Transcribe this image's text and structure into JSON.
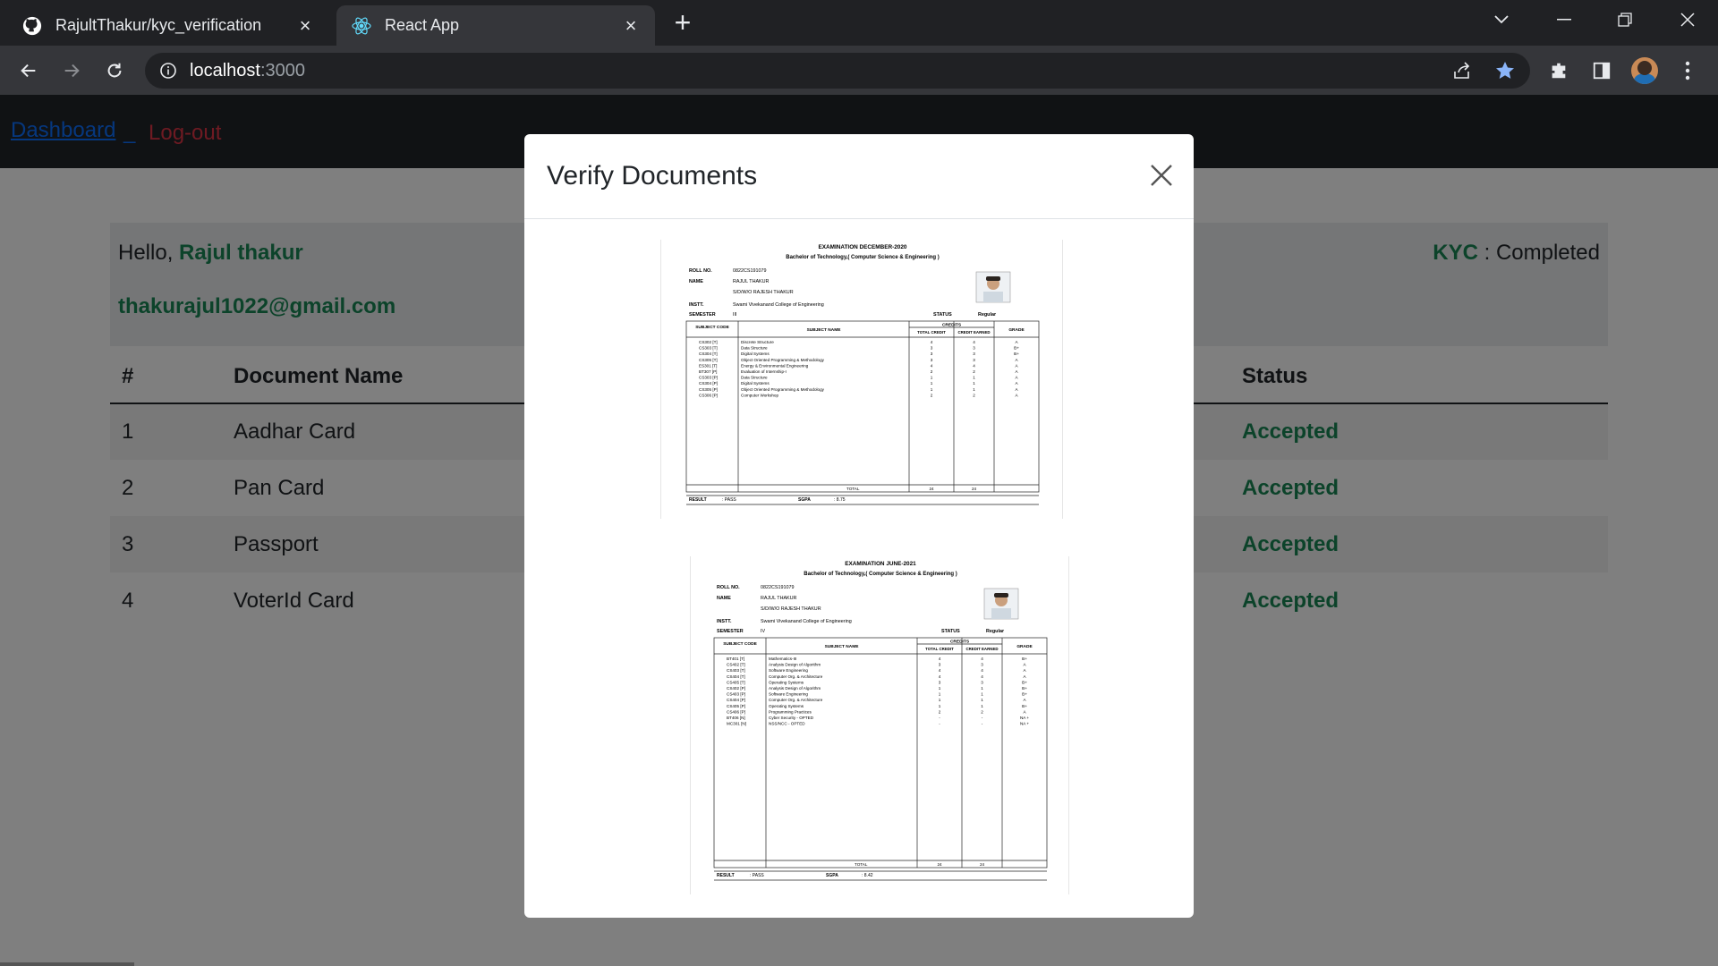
{
  "browser": {
    "tabs": [
      {
        "title": "RajultThakur/kyc_verification",
        "icon": "github-icon"
      },
      {
        "title": "React App",
        "icon": "react-icon"
      }
    ],
    "url_host": "localhost",
    "url_port": ":3000"
  },
  "nav": {
    "dashboard": "Dashboard",
    "separator": "_",
    "logout": "Log-out"
  },
  "user": {
    "greeting": "Hello,",
    "name": "Rajul thakur",
    "email": "thakurajul1022@gmail.com",
    "kyc_label": "KYC",
    "kyc_sep": " : ",
    "kyc_status": "Completed"
  },
  "table": {
    "headers": [
      "#",
      "Document Name",
      "Status"
    ],
    "rows": [
      {
        "num": "1",
        "name": "Aadhar Card",
        "status": "Accepted"
      },
      {
        "num": "2",
        "name": "Pan Card",
        "status": "Accepted"
      },
      {
        "num": "3",
        "name": "Passport",
        "status": "Accepted"
      },
      {
        "num": "4",
        "name": "VoterId Card",
        "status": "Accepted"
      }
    ]
  },
  "modal": {
    "title": "Verify Documents",
    "documents": [
      {
        "exam": "EXAMINATION DECEMBER-2020",
        "degree": "Bachelor of Technology,( Computer Science & Engineering )",
        "roll_label": "ROLL NO.",
        "roll": "0822CS191079",
        "name_label": "NAME",
        "name": "RAJUL THAKUR",
        "guardian": "S/D/W/O RAJESH THAKUR",
        "inst_label": "INSTT.",
        "inst": "Swami Vivekanand College of Engineering",
        "semester_label": "SEMESTER",
        "semester": "III",
        "status_label": "STATUS",
        "status": "Regular",
        "col_code": "SUBJECT CODE",
        "col_name": "SUBJECT NAME",
        "col_credits": "CREDITS",
        "col_total": "TOTAL CREDIT",
        "col_earned": "CREDIT EARNED",
        "col_grade": "GRADE",
        "subjects": [
          {
            "code": "CS302 [T]",
            "name": "Discrete Structure",
            "total": "4",
            "earned": "4",
            "grade": "A"
          },
          {
            "code": "CS303 [T]",
            "name": "Data Structure",
            "total": "3",
            "earned": "3",
            "grade": "B+"
          },
          {
            "code": "CS304 [T]",
            "name": "Digital Systems",
            "total": "3",
            "earned": "3",
            "grade": "B+"
          },
          {
            "code": "CS305 [T]",
            "name": "Object Oriented Programming & Methodology",
            "total": "3",
            "earned": "3",
            "grade": "A"
          },
          {
            "code": "ES301 [T]",
            "name": "Energy & Environmental Engineering",
            "total": "4",
            "earned": "4",
            "grade": "A"
          },
          {
            "code": "BT307 [P]",
            "name": "Evaluation of Internship-I",
            "total": "2",
            "earned": "2",
            "grade": "A"
          },
          {
            "code": "CS303 [P]",
            "name": "Data Structure",
            "total": "1",
            "earned": "1",
            "grade": "A"
          },
          {
            "code": "CS304 [P]",
            "name": "Digital Systems",
            "total": "1",
            "earned": "1",
            "grade": "A"
          },
          {
            "code": "CS305 [P]",
            "name": "Object Oriented Programming & Methodology",
            "total": "1",
            "earned": "1",
            "grade": "A"
          },
          {
            "code": "CS306 [P]",
            "name": "Computer Workshop",
            "total": "2",
            "earned": "2",
            "grade": "A"
          }
        ],
        "total_label": "TOTAL",
        "total": "24",
        "total_earned": "24",
        "result_label": "RESULT",
        "result": "PASS",
        "sgpa_label": "SGPA",
        "sgpa": "8.75"
      },
      {
        "exam": "EXAMINATION JUNE-2021",
        "degree": "Bachelor of Technology,( Computer Science & Engineering )",
        "roll_label": "ROLL NO.",
        "roll": "0822CS191079",
        "name_label": "NAME",
        "name": "RAJUL THAKUR",
        "guardian": "S/D/W/O RAJESH THAKUR",
        "inst_label": "INSTT.",
        "inst": "Swami Vivekanand College of Engineering",
        "semester_label": "SEMESTER",
        "semester": "IV",
        "status_label": "STATUS",
        "status": "Regular",
        "col_code": "SUBJECT CODE",
        "col_name": "SUBJECT NAME",
        "col_credits": "CREDITS",
        "col_total": "TOTAL CREDIT",
        "col_earned": "CREDIT EARNED",
        "col_grade": "GRADE",
        "subjects": [
          {
            "code": "BT401 [T]",
            "name": "Mathematics-III",
            "total": "4",
            "earned": "4",
            "grade": "B+"
          },
          {
            "code": "CS402 [T]",
            "name": "Analysis Design of Algorithm",
            "total": "3",
            "earned": "3",
            "grade": "A"
          },
          {
            "code": "CS403 [T]",
            "name": "Software Engineering",
            "total": "4",
            "earned": "4",
            "grade": "A"
          },
          {
            "code": "CS404 [T]",
            "name": "Computer Org. & Architecture",
            "total": "4",
            "earned": "4",
            "grade": "A"
          },
          {
            "code": "CS405 [T]",
            "name": "Operating Systems",
            "total": "3",
            "earned": "3",
            "grade": "B+"
          },
          {
            "code": "CS402 [P]",
            "name": "Analysis Design of Algorithm",
            "total": "1",
            "earned": "1",
            "grade": "B+"
          },
          {
            "code": "CS403 [P]",
            "name": "Software Engineering",
            "total": "1",
            "earned": "1",
            "grade": "B+"
          },
          {
            "code": "CS404 [P]",
            "name": "Computer Org. & Architecture",
            "total": "1",
            "earned": "1",
            "grade": "A"
          },
          {
            "code": "CS405 [P]",
            "name": "Operating Systems",
            "total": "1",
            "earned": "1",
            "grade": "B+"
          },
          {
            "code": "CS406 [P]",
            "name": "Programming Practices",
            "total": "2",
            "earned": "2",
            "grade": "A"
          },
          {
            "code": "BT406 [N]",
            "name": "Cyber Security - OPTED",
            "total": "-",
            "earned": "-",
            "grade": "NA +"
          },
          {
            "code": "MC301 [N]",
            "name": "NSS/NCC - OPTED",
            "total": "-",
            "earned": "-",
            "grade": "NA +"
          }
        ],
        "total_label": "TOTAL",
        "total": "24",
        "total_earned": "24",
        "result_label": "RESULT",
        "result": "PASS",
        "sgpa_label": "SGPA",
        "sgpa": "8.42"
      }
    ]
  }
}
